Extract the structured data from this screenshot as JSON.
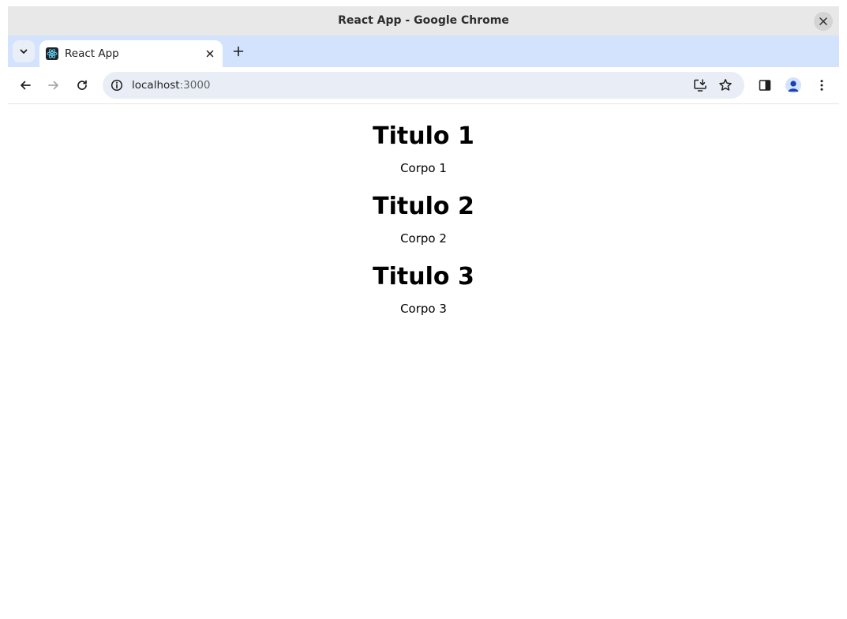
{
  "window": {
    "title": "React App - Google Chrome"
  },
  "tabs": [
    {
      "title": "React App",
      "favicon": "react-icon"
    }
  ],
  "toolbar": {
    "url_host": "localhost",
    "url_port": ":3000",
    "icons": [
      "back-arrow-icon",
      "forward-arrow-icon",
      "reload-icon",
      "site-info-icon",
      "install-app-icon",
      "bookmark-star-icon",
      "side-panel-icon",
      "profile-avatar-icon",
      "more-menu-icon"
    ]
  },
  "page": {
    "sections": [
      {
        "title": "Titulo 1",
        "body": "Corpo 1"
      },
      {
        "title": "Titulo 2",
        "body": "Corpo 2"
      },
      {
        "title": "Titulo 3",
        "body": "Corpo 3"
      }
    ]
  },
  "colors": {
    "tabstrip": "#d3e3fd",
    "titlebar": "#e8e8e8",
    "omnibox": "#e9eef6",
    "react_blue": "#61dafb",
    "avatar": "#1a3fb8"
  }
}
